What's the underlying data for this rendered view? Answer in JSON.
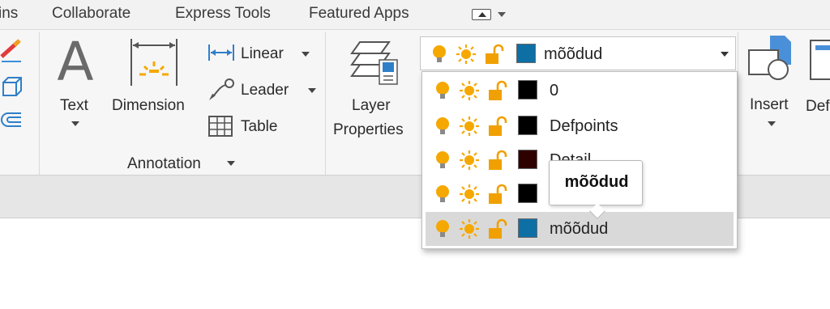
{
  "tabs": [
    {
      "label": "ins"
    },
    {
      "label": "Collaborate"
    },
    {
      "label": "Express Tools"
    },
    {
      "label": "Featured Apps"
    }
  ],
  "annotation": {
    "text_label": "Text",
    "dimension_label": "Dimension",
    "linear_label": "Linear",
    "leader_label": "Leader",
    "table_label": "Table",
    "panel_title": "Annotation"
  },
  "layers": {
    "properties_label_line1": "Layer",
    "properties_label_line2": "Properties",
    "current": {
      "name": "mõõdud",
      "color": "#0e6fa5"
    },
    "list": [
      {
        "name": "0",
        "color": "#000000"
      },
      {
        "name": "Defpoints",
        "color": "#000000"
      },
      {
        "name": "Detail",
        "color": "#2e0000"
      },
      {
        "name": "",
        "color": "#000000"
      },
      {
        "name": "mõõdud",
        "color": "#0e6fa5",
        "selected": true
      }
    ],
    "tooltip": "mõõdud"
  },
  "block": {
    "insert_label": "Insert",
    "next_label": "Def"
  },
  "colors": {
    "accent_yellow": "#f5a800",
    "lock_orange": "#f0a000",
    "selection": "#d9d9d9",
    "ribbon_bg": "#f6f6f6"
  }
}
